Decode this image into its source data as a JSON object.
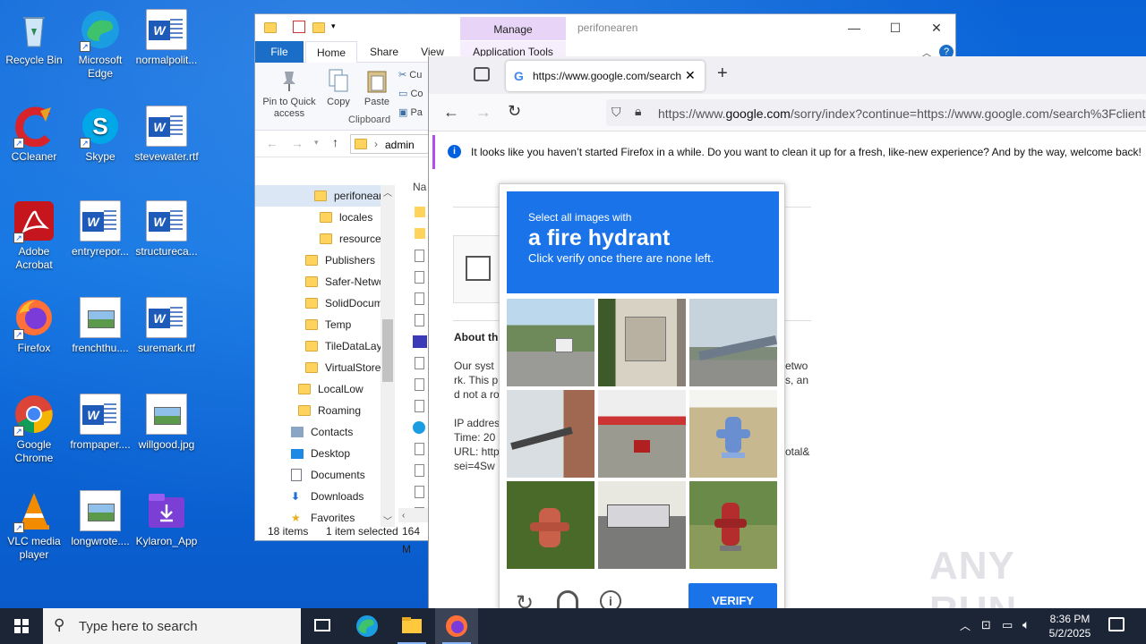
{
  "desktop": {
    "icons": [
      {
        "label": "Recycle Bin",
        "icon": "recycle-bin-icon"
      },
      {
        "label": "Microsoft Edge",
        "icon": "edge-icon"
      },
      {
        "label": "normalpolit...",
        "icon": "word-doc-icon"
      },
      {
        "label": "CCleaner",
        "icon": "ccleaner-icon"
      },
      {
        "label": "Skype",
        "icon": "skype-icon"
      },
      {
        "label": "stevewater.rtf",
        "icon": "word-doc-icon"
      },
      {
        "label": "Adobe Acrobat",
        "icon": "acrobat-icon"
      },
      {
        "label": "entryrepor...",
        "icon": "word-doc-icon"
      },
      {
        "label": "structureca...",
        "icon": "word-doc-icon"
      },
      {
        "label": "Firefox",
        "icon": "firefox-icon"
      },
      {
        "label": "frenchthu....",
        "icon": "image-file-icon"
      },
      {
        "label": "suremark.rtf",
        "icon": "word-doc-icon"
      },
      {
        "label": "Google Chrome",
        "icon": "chrome-icon"
      },
      {
        "label": "frompaper....",
        "icon": "word-doc-icon"
      },
      {
        "label": "willgood.jpg",
        "icon": "image-file-icon"
      },
      {
        "label": "VLC media player",
        "icon": "vlc-icon"
      },
      {
        "label": "longwrote....",
        "icon": "image-file-icon"
      },
      {
        "label": "Kylaron_App",
        "icon": "installer-icon"
      }
    ]
  },
  "explorer": {
    "manage_label": "Manage",
    "window_name": "perifonearen",
    "tabs": {
      "file": "File",
      "home": "Home",
      "share": "Share",
      "view": "View",
      "app_tools": "Application Tools"
    },
    "ribbon": {
      "pin": "Pin to Quick access",
      "copy": "Copy",
      "paste": "Paste",
      "cut": "Cu",
      "copy_path": "Co",
      "paste_shortcut": "Pa",
      "group": "Clipboard"
    },
    "address": "admin",
    "column_name": "Na",
    "tree": [
      "perifonear",
      "locales",
      "resource",
      "Publishers",
      "Safer-Netwo",
      "SolidDocum",
      "Temp",
      "TileDataLay",
      "VirtualStore",
      "LocalLow",
      "Roaming",
      "Contacts",
      "Desktop",
      "Documents",
      "Downloads",
      "Favorites"
    ],
    "status": {
      "count": "18 items",
      "selected": "1 item selected",
      "size": "164 M"
    }
  },
  "firefox": {
    "tab_title": "https://www.google.com/search",
    "new_tab": "+",
    "url_prefix": "https://www.",
    "url_domain": "google.com",
    "url_rest": "/sorry/index?continue=https://www.google.com/search%3Fclient%",
    "notification": "It looks like you haven’t started Firefox in a while. Do you want to clean it up for a fresh, like-new experience? And by the way, welcome back!",
    "page": {
      "about": "About th",
      "p1": "Our syst",
      "p1b": "etwo",
      "p2": "rk. This p",
      "p2b": "s, an",
      "p3": "d not a ro",
      "ip": "IP addres",
      "time": "Time: 20",
      "url": "URL: http",
      "urlb": "otal&",
      "sei": "sei=4Sw"
    }
  },
  "captcha": {
    "line1": "Select all images with",
    "line2": "a fire hydrant",
    "line3": "Click verify once there are none left.",
    "verify": "VERIFY"
  },
  "taskbar": {
    "search_placeholder": "Type here to search",
    "time": "8:36 PM",
    "date": "5/2/2025"
  },
  "watermark": "ANY RUN"
}
